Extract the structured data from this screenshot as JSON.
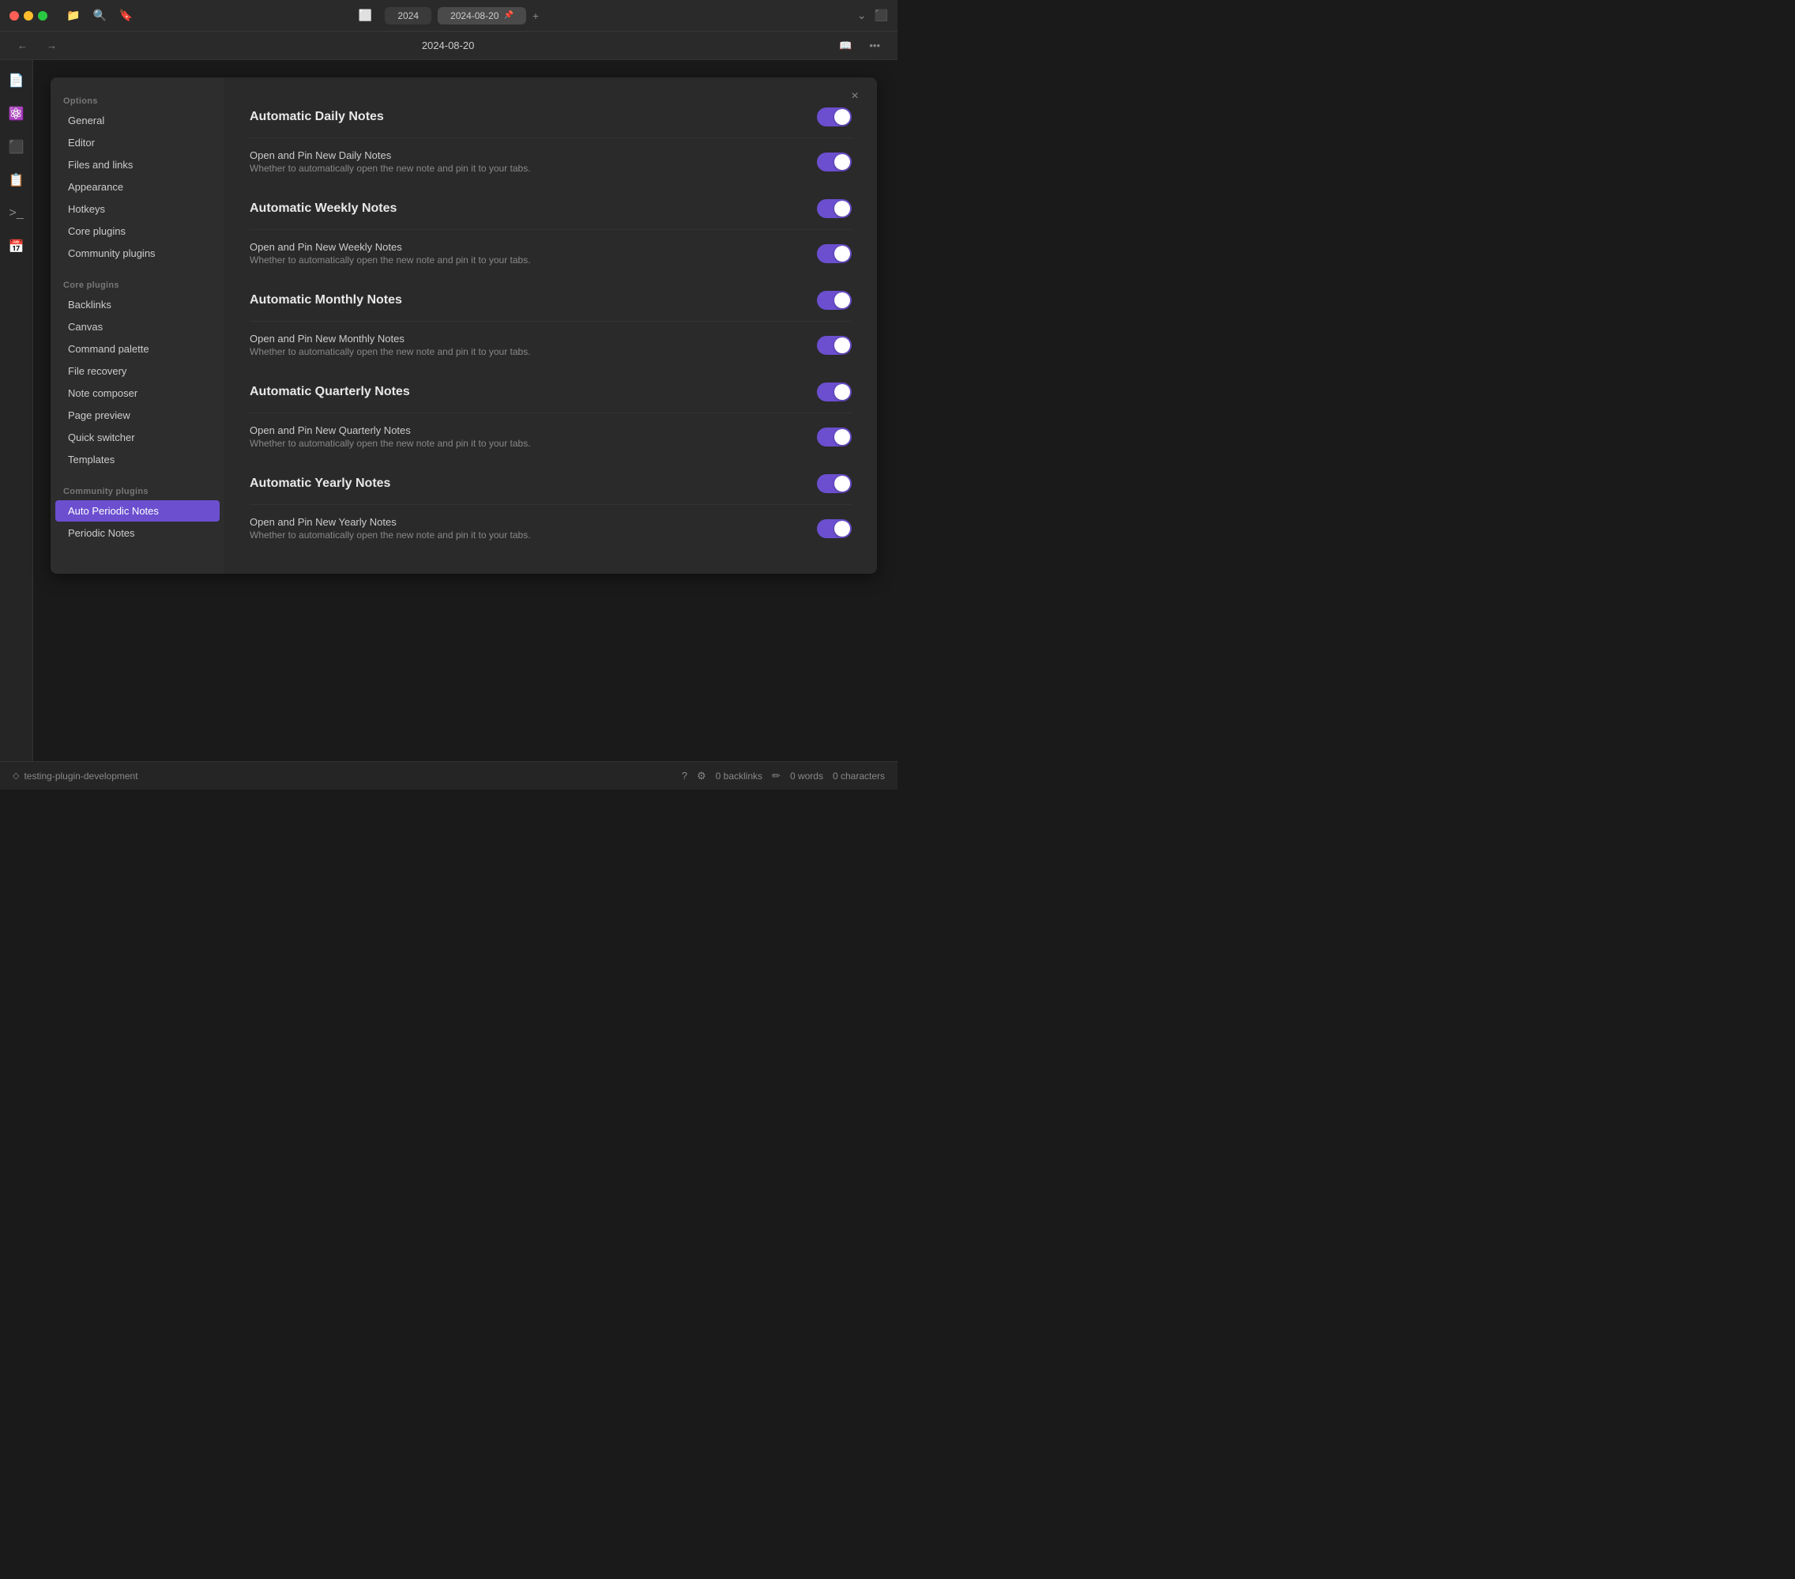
{
  "titlebar": {
    "tab1": "2024",
    "tab2": "2024-08-20",
    "pin_icon": "📌"
  },
  "subnav": {
    "title": "2024-08-20"
  },
  "settings": {
    "close_label": "×",
    "options_section": "Options",
    "options_items": [
      {
        "label": "General",
        "id": "general"
      },
      {
        "label": "Editor",
        "id": "editor"
      },
      {
        "label": "Files and links",
        "id": "files-links"
      },
      {
        "label": "Appearance",
        "id": "appearance"
      },
      {
        "label": "Hotkeys",
        "id": "hotkeys"
      },
      {
        "label": "Core plugins",
        "id": "core-plugins"
      },
      {
        "label": "Community plugins",
        "id": "community-plugins"
      }
    ],
    "core_section": "Core plugins",
    "core_items": [
      {
        "label": "Backlinks",
        "id": "backlinks"
      },
      {
        "label": "Canvas",
        "id": "canvas"
      },
      {
        "label": "Command palette",
        "id": "command-palette"
      },
      {
        "label": "File recovery",
        "id": "file-recovery"
      },
      {
        "label": "Note composer",
        "id": "note-composer"
      },
      {
        "label": "Page preview",
        "id": "page-preview"
      },
      {
        "label": "Quick switcher",
        "id": "quick-switcher"
      },
      {
        "label": "Templates",
        "id": "templates"
      }
    ],
    "community_section": "Community plugins",
    "community_items": [
      {
        "label": "Auto Periodic Notes",
        "id": "auto-periodic-notes",
        "active": true
      },
      {
        "label": "Periodic Notes",
        "id": "periodic-notes"
      }
    ],
    "content": {
      "rows": [
        {
          "id": "daily-main",
          "label": "Automatic Daily Notes",
          "is_heading": true,
          "toggled": true
        },
        {
          "id": "daily-sub",
          "label": "Open and Pin New Daily Notes",
          "desc": "Whether to automatically open the new note and pin it to your tabs.",
          "is_heading": false,
          "toggled": true
        },
        {
          "id": "weekly-main",
          "label": "Automatic Weekly Notes",
          "is_heading": true,
          "toggled": true
        },
        {
          "id": "weekly-sub",
          "label": "Open and Pin New Weekly Notes",
          "desc": "Whether to automatically open the new note and pin it to your tabs.",
          "is_heading": false,
          "toggled": true
        },
        {
          "id": "monthly-main",
          "label": "Automatic Monthly Notes",
          "is_heading": true,
          "toggled": true
        },
        {
          "id": "monthly-sub",
          "label": "Open and Pin New Monthly Notes",
          "desc": "Whether to automatically open the new note and pin it to your tabs.",
          "is_heading": false,
          "toggled": true
        },
        {
          "id": "quarterly-main",
          "label": "Automatic Quarterly Notes",
          "is_heading": true,
          "toggled": true
        },
        {
          "id": "quarterly-sub",
          "label": "Open and Pin New Quarterly Notes",
          "desc": "Whether to automatically open the new note and pin it to your tabs.",
          "is_heading": false,
          "toggled": true
        },
        {
          "id": "yearly-main",
          "label": "Automatic Yearly Notes",
          "is_heading": true,
          "toggled": true
        },
        {
          "id": "yearly-sub",
          "label": "Open and Pin New Yearly Notes",
          "desc": "Whether to automatically open the new note and pin it to your tabs.",
          "is_heading": false,
          "toggled": true
        }
      ]
    }
  },
  "statusbar": {
    "workspace": "testing-plugin-development",
    "backlinks": "0 backlinks",
    "words": "0 words",
    "characters": "0 characters"
  }
}
